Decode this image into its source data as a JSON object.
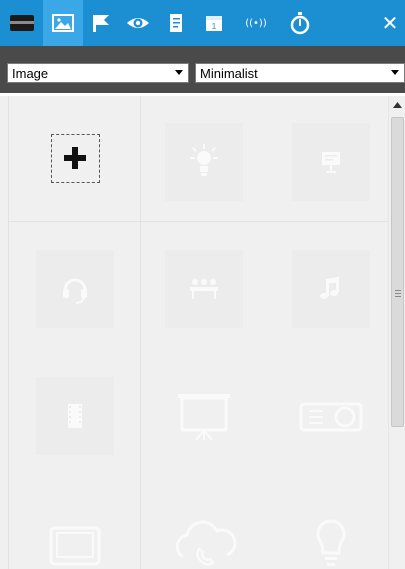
{
  "toolbar": {
    "tabs": [
      {
        "icon": "layout-icon",
        "active": false
      },
      {
        "icon": "image-icon",
        "active": true
      },
      {
        "icon": "flag-icon",
        "active": false
      },
      {
        "icon": "eye-icon",
        "active": false
      },
      {
        "icon": "document-icon",
        "active": false
      },
      {
        "icon": "calendar-icon",
        "active": false
      },
      {
        "icon": "broadcast-icon",
        "active": false
      },
      {
        "icon": "stopwatch-icon",
        "active": false
      }
    ],
    "calendar_day": "1",
    "broadcast_label": "((•))",
    "close_label": "✕",
    "colors": {
      "bar": "#1b8fd2",
      "active": "#3aa8e6",
      "icon": "#ffffff"
    }
  },
  "filters": {
    "category": "Image",
    "style": "Minimalist"
  },
  "gallery": {
    "items": [
      {
        "icon": "add-icon",
        "kind": "add"
      },
      {
        "icon": "light-bulb-on-icon"
      },
      {
        "icon": "presentation-board-icon"
      },
      {
        "icon": "headset-icon"
      },
      {
        "icon": "audience-chairs-icon"
      },
      {
        "icon": "music-note-icon"
      },
      {
        "icon": "film-strip-icon"
      },
      {
        "icon": "projector-screen-icon"
      },
      {
        "icon": "projector-icon"
      },
      {
        "icon": "tablet-icon"
      },
      {
        "icon": "cloud-phone-icon"
      },
      {
        "icon": "light-bulb-outline-icon"
      }
    ]
  }
}
